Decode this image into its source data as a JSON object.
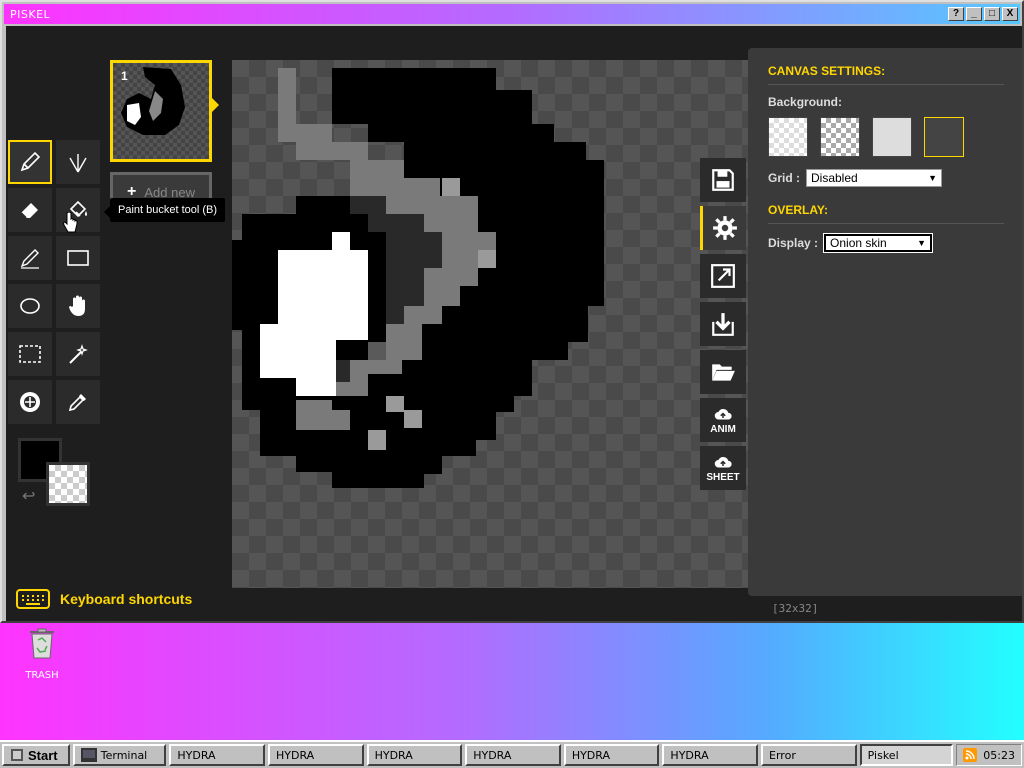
{
  "window": {
    "title": "PISKEL",
    "buttons": [
      "?",
      "_",
      "□",
      "X"
    ]
  },
  "tools": {
    "items": [
      {
        "name": "pen-tool",
        "icon": "pencil-icon",
        "active": true
      },
      {
        "name": "vertical-mirror-tool",
        "icon": "mirror-pen-icon"
      },
      {
        "name": "eraser-tool",
        "icon": "eraser-icon"
      },
      {
        "name": "paint-bucket-tool",
        "icon": "paint-bucket-icon"
      },
      {
        "name": "stroke-tool",
        "icon": "stroke-icon"
      },
      {
        "name": "rectangle-tool",
        "icon": "rectangle-icon"
      },
      {
        "name": "circle-tool",
        "icon": "circle-icon"
      },
      {
        "name": "move-tool",
        "icon": "hand-icon"
      },
      {
        "name": "rectangle-select-tool",
        "icon": "dashed-rect-icon"
      },
      {
        "name": "shape-select-tool",
        "icon": "magic-wand-icon"
      },
      {
        "name": "lighten-tool",
        "icon": "lighten-icon"
      },
      {
        "name": "color-picker-tool",
        "icon": "eyedropper-icon"
      }
    ],
    "tooltip": "Paint bucket tool (B)",
    "primary_color": "#000000",
    "secondary_color": "transparent",
    "keyboard_shortcuts": "Keyboard shortcuts"
  },
  "frames": {
    "current": "1",
    "add_new": "Add new"
  },
  "canvas": {
    "size": "[32x32]"
  },
  "side_toolbar": {
    "items": [
      {
        "name": "save-button",
        "icon": "save-icon"
      },
      {
        "name": "settings-button",
        "icon": "gear-icon",
        "active": true
      },
      {
        "name": "resize-button",
        "icon": "resize-icon"
      },
      {
        "name": "export-button",
        "icon": "download-icon"
      },
      {
        "name": "import-button",
        "icon": "folder-icon"
      },
      {
        "name": "upload-anim-button",
        "icon": "cloud-upload-icon",
        "label": "ANIM"
      },
      {
        "name": "upload-sheet-button",
        "icon": "cloud-upload-icon",
        "label": "SHEET"
      }
    ]
  },
  "settings": {
    "canvas_heading": "CANVAS SETTINGS:",
    "background_label": "Background:",
    "grid_label": "Grid :",
    "grid_value": "Disabled",
    "overlay_heading": "OVERLAY:",
    "display_label": "Display :",
    "display_value": "Onion skin"
  },
  "desktop": {
    "trash_label": "TRASH"
  },
  "taskbar": {
    "start": "Start",
    "tasks": [
      "Terminal",
      "HYDRA",
      "HYDRA",
      "HYDRA",
      "HYDRA",
      "HYDRA",
      "HYDRA",
      "Error",
      "Piskel"
    ],
    "active_task": "Piskel",
    "clock": "05:23"
  },
  "colors": {
    "accent": "#ffd700",
    "panel": "#3a3a3a",
    "app_bg": "#1e1e1e"
  }
}
